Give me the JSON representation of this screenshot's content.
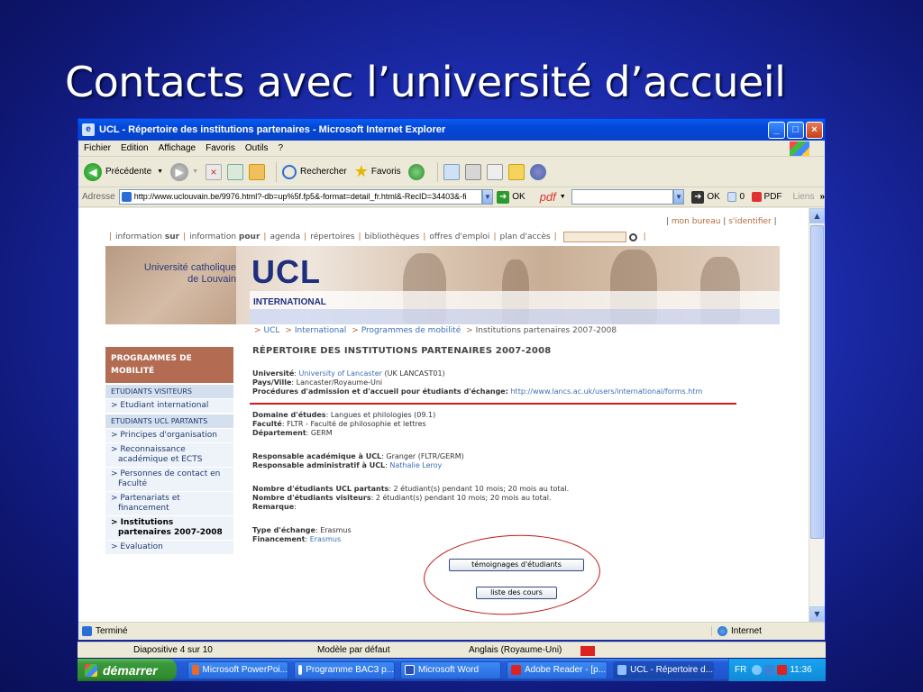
{
  "slide": {
    "title": "Contacts avec l’université d’accueil"
  },
  "window": {
    "title": "UCL - Répertoire des institutions partenaires - Microsoft Internet Explorer",
    "buttons": [
      "_",
      "□",
      "×"
    ]
  },
  "menubar": [
    "Fichier",
    "Edition",
    "Affichage",
    "Favoris",
    "Outils",
    "?"
  ],
  "toolbar": {
    "back": "Précédente",
    "search": "Rechercher",
    "favorites": "Favoris"
  },
  "addressbar": {
    "label": "Adresse",
    "url": "http://www.uclouvain.be/9976.html?-db=up%5f.fp5&-format=detail_fr.html&-RecID=34403&-fi",
    "go": "OK",
    "pdf": "pdf",
    "ok2": "OK",
    "count": "0",
    "pdf_btn": "PDF",
    "links": "Liens"
  },
  "site": {
    "top_right": {
      "mon_bureau": "mon bureau",
      "sidentifier": "s'identifier"
    },
    "topnav": {
      "info_sur_prefix": "information ",
      "info_sur_bold": "sur",
      "info_pour_prefix": "information ",
      "info_pour_bold": "pour",
      "items": [
        "agenda",
        "répertoires",
        "bibliothèques",
        "offres d'emploi",
        "plan d'accès"
      ]
    },
    "banner": {
      "uni_line1": "Université catholique",
      "uni_line2": "de Louvain",
      "logo": "UCL",
      "section": "INTERNATIONAL"
    },
    "breadcrumb": {
      "items": [
        "UCL",
        "International",
        "Programmes de mobilité"
      ],
      "current": "Institutions partenaires 2007-2008"
    },
    "leftnav": {
      "heading": "PROGRAMMES DE MOBILITÉ",
      "sections": [
        {
          "title": "ETUDIANTS VISITEURS",
          "items": [
            "> Etudiant international"
          ]
        },
        {
          "title": "ETUDIANTS UCL PARTANTS",
          "items": [
            "> Principes d'organisation",
            "> Reconnaissance académique et ECTS",
            "> Personnes de contact en Faculté",
            "> Partenariats et financement",
            "> Institutions partenaires 2007-2008",
            "> Evaluation"
          ]
        }
      ]
    },
    "main": {
      "heading": "RÉPERTOIRE DES INSTITUTIONS PARTENAIRES 2007-2008",
      "universite_label": "Université",
      "universite_value": "University of Lancaster",
      "universite_code": "(UK LANCAST01)",
      "pays_label": "Pays/Ville",
      "pays_value": "Lancaster/Royaume-Uni",
      "procedures_label": "Procédures d'admission et d'accueil pour étudiants d'échange:",
      "procedures_url": "http://www.lancs.ac.uk/users/international/forms.htm",
      "domaine_label": "Domaine d'études",
      "domaine_value": "Langues et philologies (09.1)",
      "faculte_label": "Faculté",
      "faculte_value": "FLTR - Faculté de philosophie et lettres",
      "departement_label": "Département",
      "departement_value": "GERM",
      "resp_acad_label": "Responsable académique à UCL",
      "resp_acad_value": "Granger (FLTR/GERM)",
      "resp_admin_label": "Responsable administratif à UCL",
      "resp_admin_value": "Nathalie Leroy",
      "nb_partants_label": "Nombre d'étudiants UCL partants",
      "nb_partants_value": "2 étudiant(s) pendant 10 mois; 20 mois au total.",
      "nb_visiteurs_label": "Nombre d'étudiants visiteurs",
      "nb_visiteurs_value": "2 étudiant(s) pendant 10 mois; 20 mois au total.",
      "remarque_label": "Remarque",
      "type_label": "Type d'échange",
      "type_value": "Erasmus",
      "financement_label": "Financement",
      "financement_value": "Erasmus",
      "btn_temoignages": "témoignages d'étudiants",
      "btn_cours": "liste des cours"
    }
  },
  "statusbar": {
    "left": "Terminé",
    "zone": "Internet"
  },
  "ppt_status": {
    "slide": "Diapositive 4 sur 10",
    "design": "Modèle par défaut",
    "lang": "Anglais (Royaume-Uni)"
  },
  "taskbar": {
    "start": "démarrer",
    "tasks": [
      "Microsoft PowerPoi...",
      "Programme BAC3 p...",
      "Microsoft Word",
      "Adobe Reader - [p...",
      "UCL - Répertoire d..."
    ],
    "lang": "FR",
    "clock": "11:36"
  },
  "colors": {
    "accent_red": "#d21a1a",
    "link_blue": "#3a6fb5",
    "ucl_blue": "#1e2f7e",
    "nav_brown": "#b36b52"
  }
}
